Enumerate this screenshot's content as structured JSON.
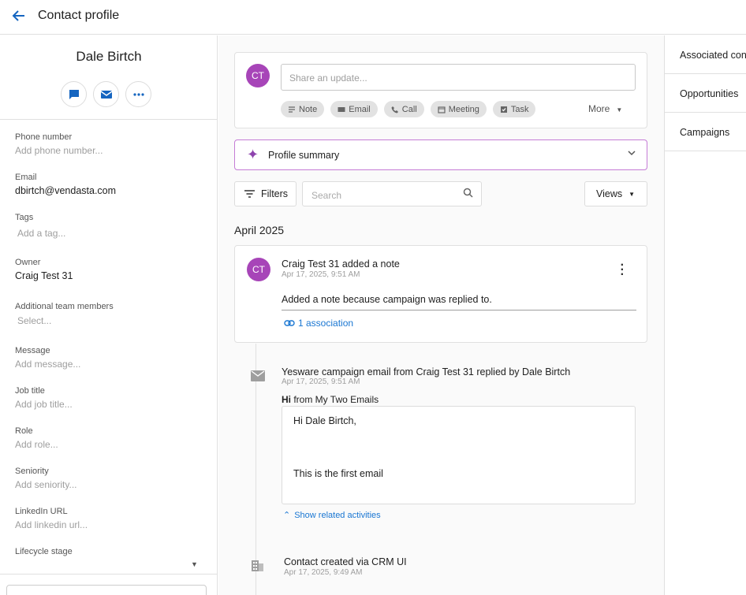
{
  "header": {
    "title": "Contact profile"
  },
  "contact": {
    "name": "Dale Birtch",
    "fields": [
      {
        "label": "Phone number",
        "value": "Add phone number..."
      },
      {
        "label": "Email",
        "value": "dbirtch@vendasta.com"
      },
      {
        "label": "Tags",
        "value": "Add a tag..."
      },
      {
        "label": "Owner",
        "value": "Craig Test 31"
      },
      {
        "label": "Additional team members",
        "value": "Select..."
      },
      {
        "label": "Message",
        "value": "Add message..."
      },
      {
        "label": "Job title",
        "value": "Add job title..."
      },
      {
        "label": "Role",
        "value": "Add role..."
      },
      {
        "label": "Seniority",
        "value": "Add seniority..."
      },
      {
        "label": "LinkedIn URL",
        "value": "Add linkedin url..."
      },
      {
        "label": "Lifecycle stage",
        "value": ""
      }
    ]
  },
  "composer": {
    "avatar": "CT",
    "placeholder": "Share an update...",
    "chips": [
      "Note",
      "Email",
      "Call",
      "Meeting",
      "Task"
    ],
    "more": "More"
  },
  "summary": {
    "label": "Profile summary"
  },
  "toolbar": {
    "filters": "Filters",
    "search_placeholder": "Search",
    "views": "Views"
  },
  "timeline": {
    "month": "April 2025",
    "note": {
      "avatar": "CT",
      "title": "Craig Test 31 added a note",
      "date": "Apr 17, 2025, 9:51 AM",
      "body": "Added a note because campaign was replied to.",
      "association": "1 association"
    },
    "email": {
      "title": "Yesware campaign email from Craig Test 31 replied by Dale Birtch",
      "date": "Apr 17, 2025, 9:51 AM",
      "subject_bold": "Hi",
      "subject_rest": " from My Two Emails",
      "greeting": "Hi Dale Birtch,",
      "body": "This is the first email",
      "related": "Show related activities"
    },
    "created": {
      "title": "Contact created via CRM UI",
      "date": "Apr 17, 2025, 9:49 AM"
    }
  },
  "right_panel": {
    "sections": [
      "Associated contacts",
      "Opportunities",
      "Campaigns"
    ]
  },
  "colors": {
    "accent": "#1565c0",
    "avatar": "#a745b8",
    "summary_border": "#c57cd6"
  }
}
